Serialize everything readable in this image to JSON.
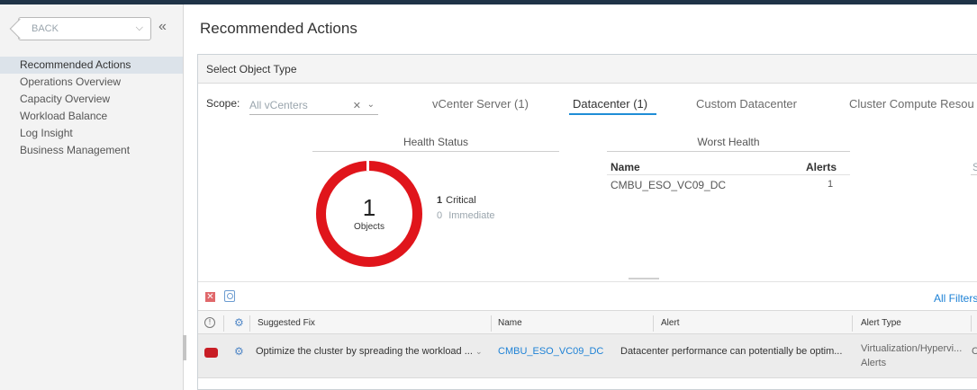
{
  "nav": {
    "back_label": "BACK",
    "items": [
      {
        "label": "Recommended Actions",
        "active": true
      },
      {
        "label": "Operations Overview"
      },
      {
        "label": "Capacity Overview"
      },
      {
        "label": "Workload Balance"
      },
      {
        "label": "Log Insight"
      },
      {
        "label": "Business Management"
      }
    ]
  },
  "page": {
    "title": "Recommended Actions"
  },
  "panel": {
    "header": "Select Object Type"
  },
  "scope": {
    "label": "Scope:",
    "value": "All vCenters"
  },
  "tabs": [
    {
      "label": "vCenter Server (1)"
    },
    {
      "label": "Datacenter (1)",
      "active": true
    },
    {
      "label": "Custom Datacenter"
    },
    {
      "label": "Cluster Compute Resou"
    }
  ],
  "health": {
    "title": "Health Status",
    "count": "1",
    "count_label": "Objects",
    "legend": [
      {
        "count": "1",
        "label": "Critical"
      },
      {
        "count": "0",
        "label": "Immediate"
      }
    ],
    "ring_color": "#e0151b"
  },
  "worst": {
    "title": "Worst Health",
    "col_name": "Name",
    "col_alerts": "Alerts",
    "rows": [
      {
        "name": "CMBU_ESO_VC09_DC",
        "alerts": "1"
      }
    ],
    "truncated_col": "S"
  },
  "toolbar": {
    "all_filters": "All Filters"
  },
  "table": {
    "headers": {
      "suggested_fix": "Suggested Fix",
      "name": "Name",
      "alert": "Alert",
      "alert_type": "Alert Type"
    },
    "rows": [
      {
        "suggested_fix": "Optimize the cluster by spreading the workload ...",
        "name": "CMBU_ESO_VC09_DC",
        "alert": "Datacenter performance can potentially be optim...",
        "alert_type_line1": "Virtualization/Hypervi...",
        "alert_type_line2": "Alerts",
        "extra": "C"
      }
    ]
  },
  "colors": {
    "accent": "#1f8dd6",
    "critical": "#c81d25",
    "link": "#1e82d6"
  }
}
